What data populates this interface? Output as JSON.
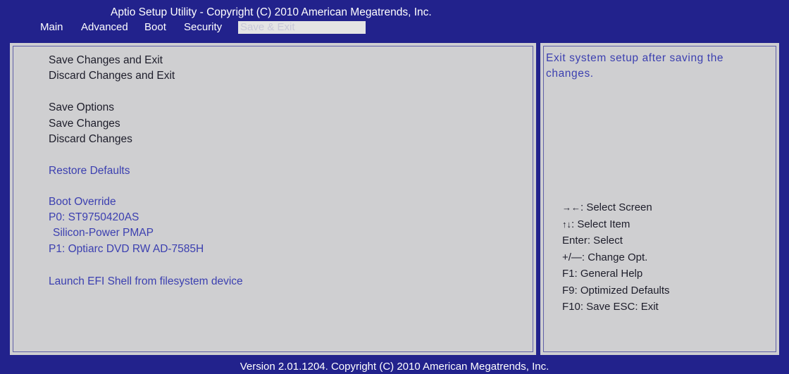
{
  "header": {
    "title": "Aptio Setup Utility - Copyright (C) 2010 American Megatrends, Inc.",
    "tabs": [
      "Main",
      "Advanced",
      "Boot",
      "Security",
      "Save & Exit"
    ]
  },
  "menu": {
    "save_changes_exit": "Save Changes and Exit",
    "discard_changes_exit": "Discard Changes and Exit",
    "save_options": "Save Options",
    "save_changes": "Save Changes",
    "discard_changes": "Discard Changes",
    "restore_defaults": "Restore Defaults",
    "boot_override": "Boot Override",
    "p0": "P0:  ST9750420AS",
    "silicon_power": " Silicon-Power PMAP",
    "p1": "P1:  Optiarc DVD RW AD-7585H",
    "launch_efi": "Launch EFI Shell from filesystem device"
  },
  "help_text": "Exit system setup after saving the changes.",
  "keys": [
    {
      "icon": "→←",
      "icon_name": "arrows-left-right-icon",
      "text": ": Select Screen"
    },
    {
      "icon": "↑↓",
      "icon_name": "arrows-up-down-icon",
      "text": ":  Select Item"
    },
    {
      "icon": "",
      "icon_name": "",
      "text": "Enter: Select"
    },
    {
      "icon": "",
      "icon_name": "",
      "text": "+/—:  Change Opt."
    },
    {
      "icon": "",
      "icon_name": "",
      "text": "F1:  General Help"
    },
    {
      "icon": "",
      "icon_name": "",
      "text": "F9:  Optimized Defaults"
    },
    {
      "icon": "",
      "icon_name": "",
      "text": "F10:  Save   ESC: Exit"
    }
  ],
  "footer": "Version 2.01.1204. Copyright (C) 2010 American Megatrends, Inc.",
  "colors": {
    "frame_blue": "#22228c",
    "panel_gray": "#cfcfd1",
    "highlight_blue": "#3b3fb0"
  }
}
